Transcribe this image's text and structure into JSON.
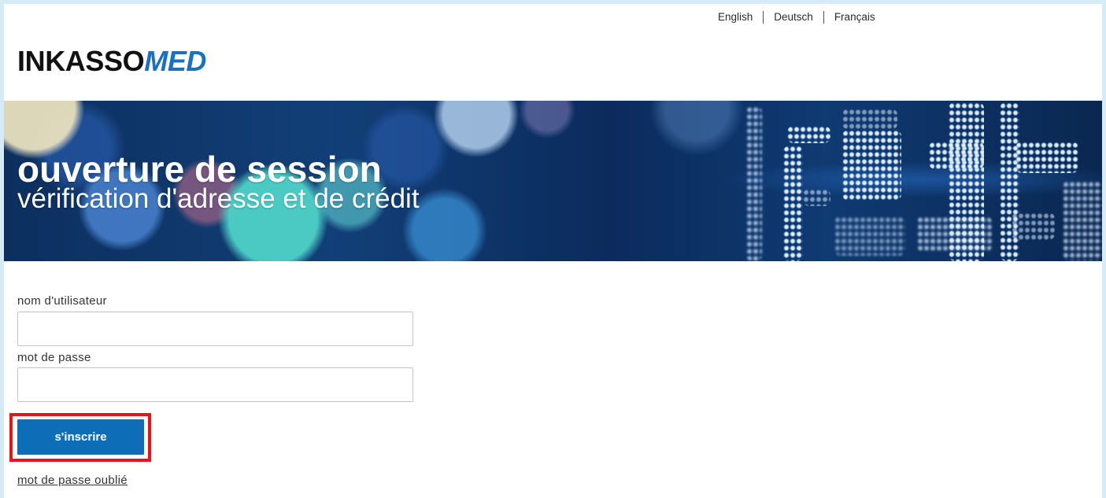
{
  "language_nav": {
    "items": [
      {
        "label": "English"
      },
      {
        "label": "Deutsch"
      },
      {
        "label": "Français"
      }
    ]
  },
  "logo": {
    "text_main": "INKASSO",
    "text_accent": "MED"
  },
  "banner": {
    "title": "ouverture de session",
    "subtitle": "vérification d'adresse et de crédit"
  },
  "login_form": {
    "username": {
      "label": "nom d'utilisateur",
      "value": ""
    },
    "password": {
      "label": "mot de passe",
      "value": ""
    },
    "submit_label": "s'inscrire",
    "forgot_password_label": "mot de passe oublié"
  },
  "colors": {
    "accent": "#0d6db6",
    "logo_accent": "#1b70c0",
    "frame": "#d6ebf6",
    "highlight": "#e8141c",
    "text": "#333333"
  }
}
